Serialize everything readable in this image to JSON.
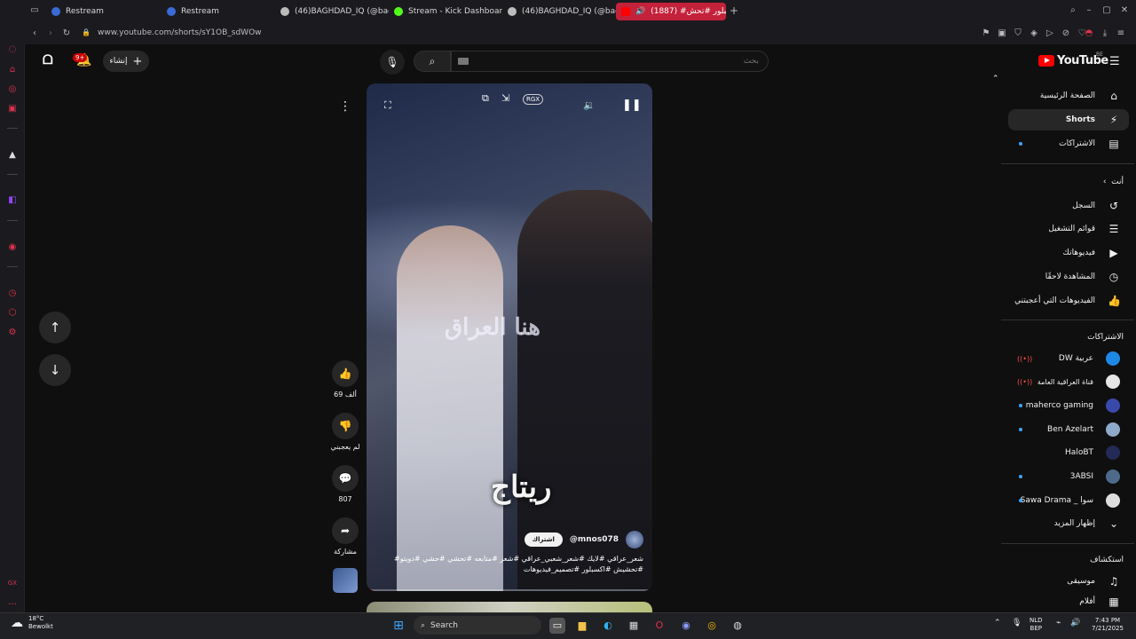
{
  "browser": {
    "tabs": [
      {
        "title": "Restream",
        "fav": "#3a6bd6"
      },
      {
        "title": "Restream",
        "fav": "#3a6bd6"
      },
      {
        "title": "(46)BAGHDAD_IQ (@bagh",
        "fav": "#bbbbbb"
      },
      {
        "title": "Stream - Kick Dashboard",
        "fav": "#53fc18"
      },
      {
        "title": "(46)BAGHDAD_IQ (@bagh",
        "fav": "#bbbbbb"
      },
      {
        "title": "(1887) #اكسبلور #تحش",
        "fav": "#ff0000"
      }
    ],
    "url": "www.youtube.com/shorts/sY1OB_sdWOw",
    "new_tab": "+"
  },
  "yt": {
    "logo_text": "YouTube",
    "region": "BE",
    "create_label": "إنشاء",
    "notif_count": "9+",
    "search_placeholder": "بحث",
    "sidebar": {
      "main": [
        {
          "label": "الصفحة الرئيسية",
          "icon": "⌂"
        },
        {
          "label": "Shorts",
          "icon": "⚡"
        },
        {
          "label": "الاشتراكات",
          "icon": "▤"
        }
      ],
      "you_header": "أنت",
      "you": [
        {
          "label": "السجل",
          "icon": "↺"
        },
        {
          "label": "قوائم التشغيل",
          "icon": "☰"
        },
        {
          "label": "فيديوهاتك",
          "icon": "▶"
        },
        {
          "label": "المشاهدة لاحقًا",
          "icon": "◷"
        },
        {
          "label": "الفيديوهات التي أعجبتني",
          "icon": "👍"
        }
      ],
      "subs_header": "الاشتراكات",
      "subs": [
        {
          "label": "DW عربية",
          "color": "#1e88e5",
          "status": "live"
        },
        {
          "label": "قناة العراقية العامة",
          "color": "#e6e6e6",
          "status": "live"
        },
        {
          "label": "maherco gaming",
          "color": "#3949ab",
          "status": "dot"
        },
        {
          "label": "Ben Azelart",
          "color": "#8fa9c8",
          "status": "dot"
        },
        {
          "label": "HaloBT",
          "color": "#222a55",
          "status": "none"
        },
        {
          "label": "3ABSI",
          "color": "#4e6a8a",
          "status": "dot"
        },
        {
          "label": "Sawa Drama _ سوا",
          "color": "#dddddd",
          "status": "dot"
        }
      ],
      "show_more": "إظهار المزيد",
      "explore_header": "استكشاف",
      "explore": [
        {
          "label": "موسيقى",
          "icon": "♫"
        },
        {
          "label": "أفلام",
          "icon": "🎬"
        }
      ]
    },
    "short": {
      "title_overlay": "ريتاج",
      "watermark": "هنا العراق",
      "channel": "@mnos078",
      "subscribe": "اشتراك",
      "description": "#شعر_عراقي #لايك #شعر_شعبي_عراقي #شعر #متابعه #تحشي #حشي #دويتو #تحشيش #اكسبلور #تصميم_فيديوهات",
      "likes": "69 ألف",
      "dislike_label": "لم يعجبني",
      "comments": "807",
      "share_label": "مشاركة",
      "progress": 0.02,
      "overlay_badge": "RGX"
    }
  },
  "taskbar": {
    "temp": "18°C",
    "weather": "Bewolkt",
    "search_label": "Search",
    "lang_top": "NLD",
    "lang_bottom": "BEP",
    "time": "7:43 PM",
    "date": "7/21/2025"
  }
}
